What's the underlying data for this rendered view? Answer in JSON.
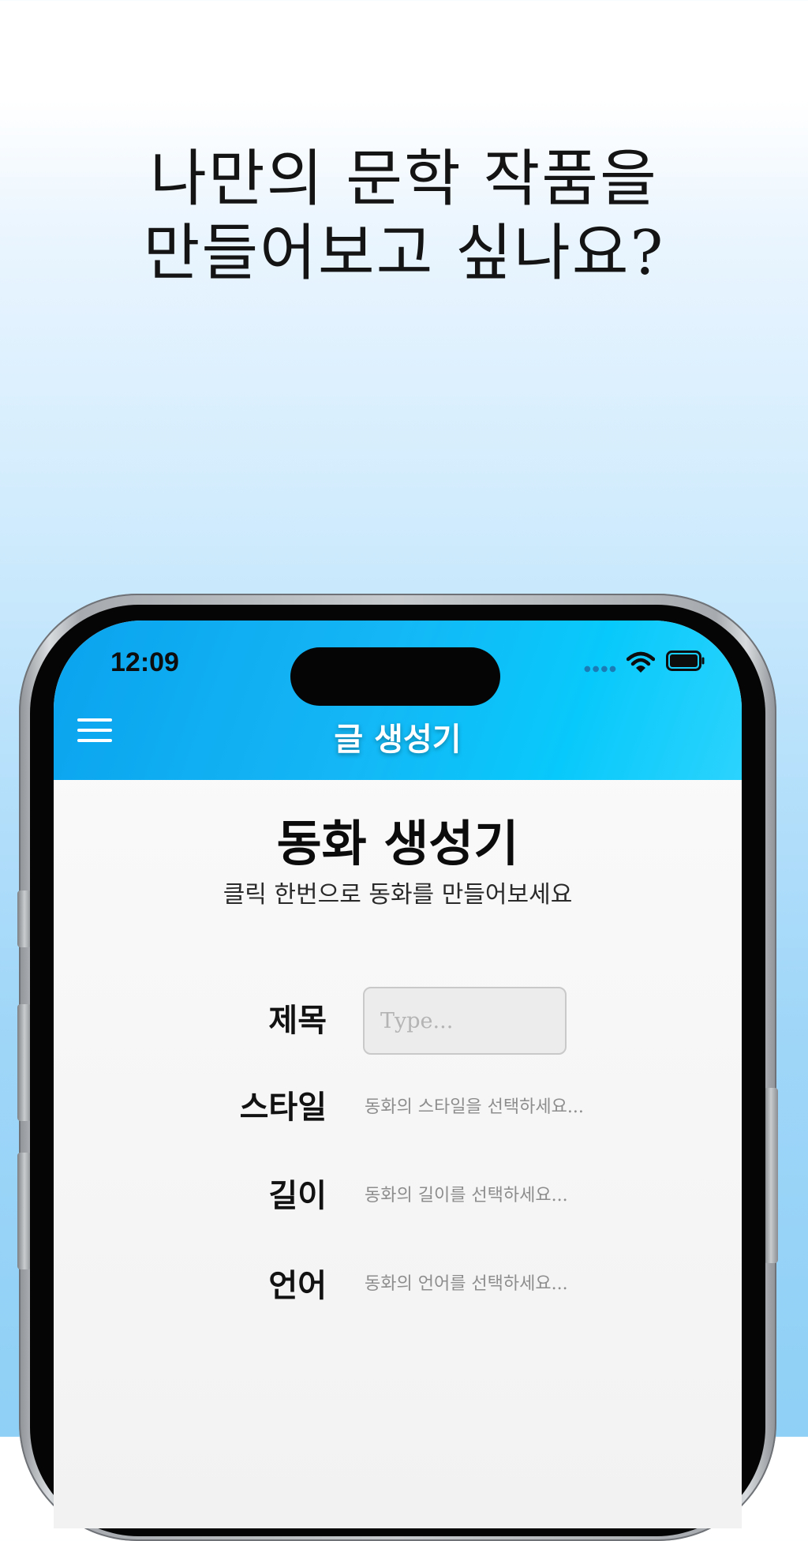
{
  "headline": {
    "line1": "나만의 문학 작품을",
    "line2": "만들어보고 싶나요?"
  },
  "status_bar": {
    "time": "12:09",
    "icons": [
      "cellular-signal-icon",
      "wifi-icon",
      "battery-icon"
    ]
  },
  "app_bar": {
    "title": "글 생성기",
    "menu_icon": "hamburger-menu-icon"
  },
  "page": {
    "title": "동화 생성기",
    "subtitle": "클릭 한번으로 동화를 만들어보세요"
  },
  "form": {
    "title": {
      "label": "제목",
      "value": "",
      "placeholder": "Type..."
    },
    "style": {
      "label": "스타일",
      "placeholder": "동화의 스타일을 선택하세요..."
    },
    "length": {
      "label": "길이",
      "placeholder": "동화의 길이를 선택하세요..."
    },
    "language": {
      "label": "언어",
      "placeholder": "동화의 언어를 선택하세요..."
    }
  },
  "colors": {
    "app_bar_start": "#0aa3ee",
    "app_bar_end": "#2bd3fd",
    "background_top": "#ffffff",
    "background_bottom": "#8fd0f6"
  }
}
